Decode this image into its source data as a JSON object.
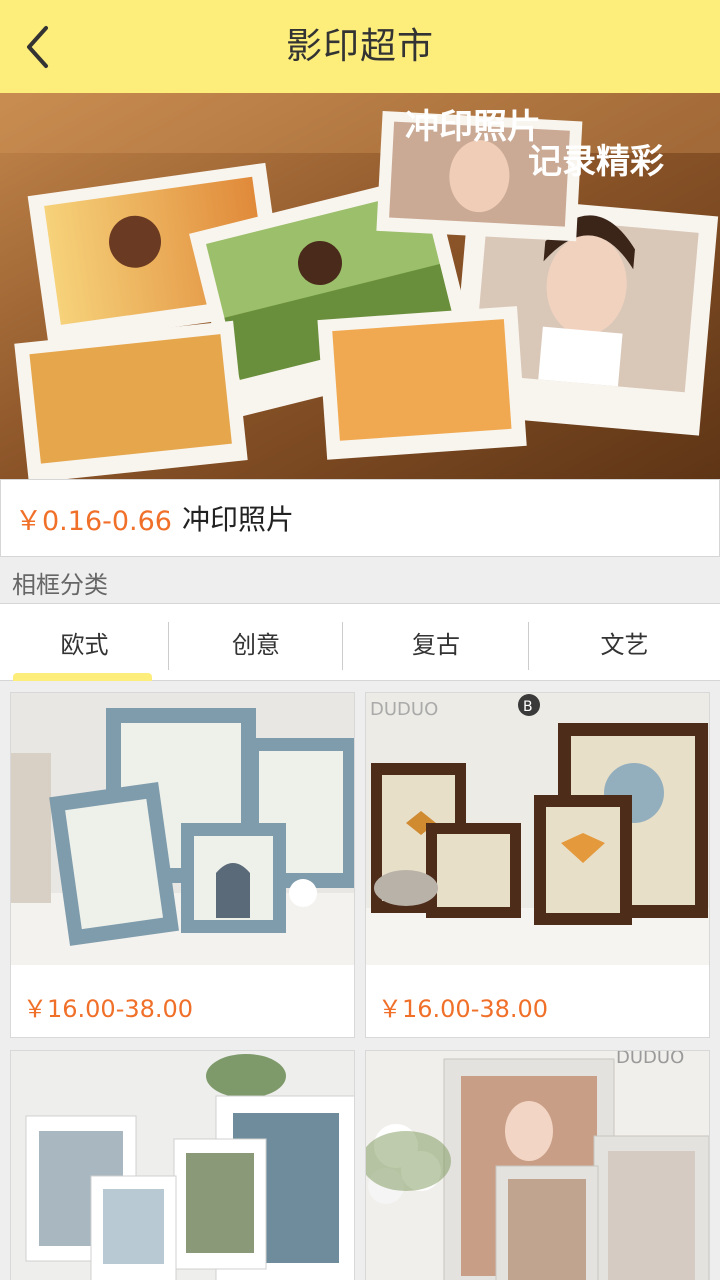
{
  "header": {
    "title": "影印超市",
    "back_icon": "chevron-left-icon"
  },
  "banner": {
    "line1": "冲印照片",
    "line2": "记录精彩"
  },
  "featured": {
    "price": "￥0.16-0.66",
    "name": "冲印照片"
  },
  "section": {
    "label": "相框分类"
  },
  "tabs": [
    {
      "label": "欧式",
      "active": true
    },
    {
      "label": "创意",
      "active": false
    },
    {
      "label": "复古",
      "active": false
    },
    {
      "label": "文艺",
      "active": false
    }
  ],
  "products": [
    {
      "price": "￥16.00-38.00",
      "image": "blue-frames-photo"
    },
    {
      "price": "￥16.00-38.00",
      "image": "brown-frames-photo",
      "watermark": "DUDUO",
      "badge": "B"
    },
    {
      "image": "white-frames-photo"
    },
    {
      "image": "white-ornate-frames-photo",
      "watermark": "DUDUO"
    }
  ],
  "colors": {
    "accent": "#fdee7c",
    "price": "#f0702a"
  }
}
